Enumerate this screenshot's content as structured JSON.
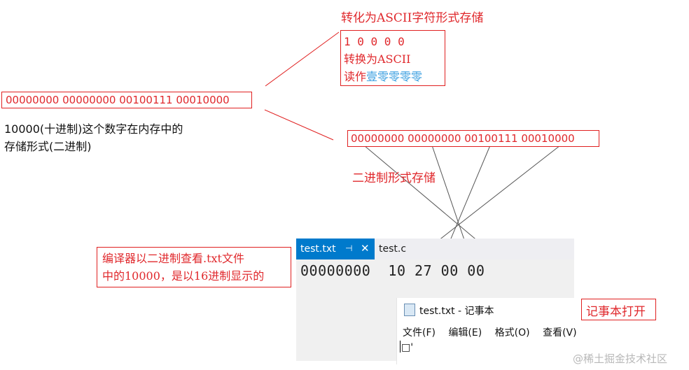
{
  "top_label": "转化为ASCII字符形式存储",
  "ascii_box": {
    "line1": "1 0 0 0 0",
    "line2": "转换为ASCII",
    "line3_prefix": "读作",
    "line3_highlight": "壹零零零零"
  },
  "memory_binary": "00000000 00000000 00100111 00010000",
  "caption_line1": "10000(十进制)这个数字在内存中的",
  "caption_line2": "存储形式(二进制)",
  "binary_box": "00000000 00000000 00100111 00010000",
  "binary_label": "二进制形式存储",
  "compiler_note_line1": "编译器以二进制查看.txt文件",
  "compiler_note_line2": "中的10000，是以16进制显示的",
  "ide": {
    "tab_active": "test.txt",
    "tab_pin": "⊣",
    "tab_close": "✕",
    "tab_inactive": "test.c",
    "hex_row": "00000000  10 27 00 00"
  },
  "notepad": {
    "title": "test.txt - 记事本",
    "menu": [
      "文件(F)",
      "编辑(E)",
      "格式(O)",
      "查看(V)"
    ],
    "content": "□'"
  },
  "notepad_label": "记事本打开",
  "watermark": "@稀土掘金技术社区",
  "colors": {
    "red": "#e02020",
    "blue_text": "#3da0e0",
    "tab_blue": "#007acc"
  }
}
